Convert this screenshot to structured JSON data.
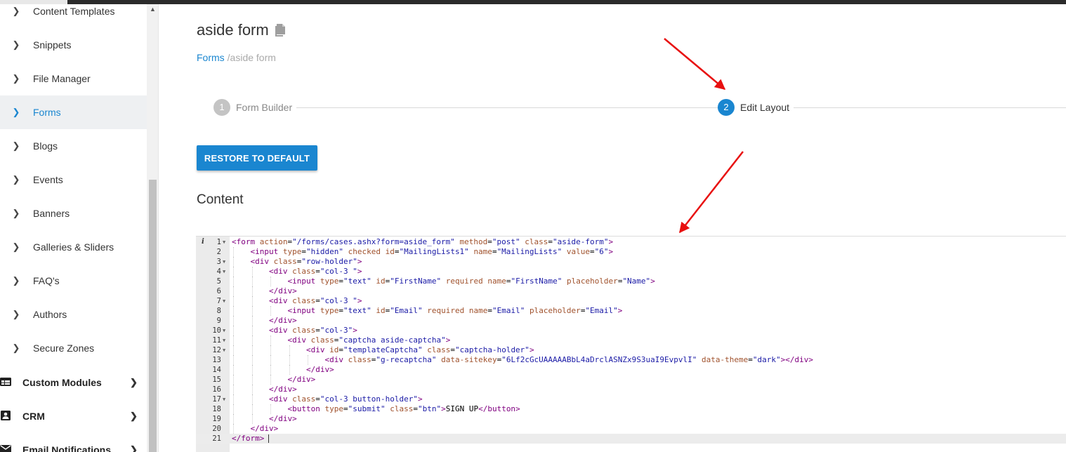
{
  "sidebar": {
    "items": [
      {
        "label": "Content Templates",
        "active": false
      },
      {
        "label": "Snippets",
        "active": false
      },
      {
        "label": "File Manager",
        "active": false
      },
      {
        "label": "Forms",
        "active": true
      },
      {
        "label": "Blogs",
        "active": false
      },
      {
        "label": "Events",
        "active": false
      },
      {
        "label": "Banners",
        "active": false
      },
      {
        "label": "Galleries & Sliders",
        "active": false
      },
      {
        "label": "FAQ's",
        "active": false
      },
      {
        "label": "Authors",
        "active": false
      },
      {
        "label": "Secure Zones",
        "active": false
      }
    ],
    "sections": [
      {
        "label": "Custom Modules",
        "icon": "module-icon"
      },
      {
        "label": "CRM",
        "icon": "contact-card-icon"
      },
      {
        "label": "Email Notifications",
        "icon": "envelope-icon"
      }
    ]
  },
  "page": {
    "title": "aside form",
    "breadcrumb": {
      "link": "Forms",
      "current": "/aside form"
    }
  },
  "stepper": {
    "steps": [
      {
        "num": "1",
        "label": "Form Builder",
        "state": "inactive"
      },
      {
        "num": "2",
        "label": "Edit Layout",
        "state": "active"
      }
    ]
  },
  "actions": {
    "restore_label": "RESTORE TO DEFAULT"
  },
  "content": {
    "heading": "Content"
  },
  "editor": {
    "lines": [
      {
        "n": "1",
        "fold": true,
        "indent": 0,
        "code": "<form action=\"/forms/cases.ashx?form=aside_form\" method=\"post\" class=\"aside-form\">"
      },
      {
        "n": "2",
        "fold": false,
        "indent": 1,
        "code": "<input type=\"hidden\" checked id=\"MailingLists1\" name=\"MailingLists\" value=\"6\">"
      },
      {
        "n": "3",
        "fold": true,
        "indent": 1,
        "code": "<div class=\"row-holder\">"
      },
      {
        "n": "4",
        "fold": true,
        "indent": 2,
        "code": "<div class=\"col-3 \">"
      },
      {
        "n": "5",
        "fold": false,
        "indent": 3,
        "code": "<input type=\"text\" id=\"FirstName\" required name=\"FirstName\" placeholder=\"Name\">"
      },
      {
        "n": "6",
        "fold": false,
        "indent": 2,
        "code": "</div>"
      },
      {
        "n": "7",
        "fold": true,
        "indent": 2,
        "code": "<div class=\"col-3 \">"
      },
      {
        "n": "8",
        "fold": false,
        "indent": 3,
        "code": "<input type=\"text\" id=\"Email\" required name=\"Email\" placeholder=\"Email\">"
      },
      {
        "n": "9",
        "fold": false,
        "indent": 2,
        "code": "</div>"
      },
      {
        "n": "10",
        "fold": true,
        "indent": 2,
        "code": "<div class=\"col-3\">"
      },
      {
        "n": "11",
        "fold": true,
        "indent": 3,
        "code": "<div class=\"captcha aside-captcha\">"
      },
      {
        "n": "12",
        "fold": true,
        "indent": 4,
        "code": "<div id=\"templateCaptcha\" class=\"captcha-holder\">"
      },
      {
        "n": "13",
        "fold": false,
        "indent": 5,
        "code": "<div class=\"g-recaptcha\" data-sitekey=\"6Lf2cGcUAAAAABbL4aDrclASNZx9S3uaI9EvpvlI\" data-theme=\"dark\"></div>"
      },
      {
        "n": "14",
        "fold": false,
        "indent": 4,
        "code": "</div>"
      },
      {
        "n": "15",
        "fold": false,
        "indent": 3,
        "code": "</div>"
      },
      {
        "n": "16",
        "fold": false,
        "indent": 2,
        "code": "</div>"
      },
      {
        "n": "17",
        "fold": true,
        "indent": 2,
        "code": "<div class=\"col-3 button-holder\">"
      },
      {
        "n": "18",
        "fold": false,
        "indent": 3,
        "code": "<button type=\"submit\" class=\"btn\">SIGN UP</button>"
      },
      {
        "n": "19",
        "fold": false,
        "indent": 2,
        "code": "</div>"
      },
      {
        "n": "20",
        "fold": false,
        "indent": 1,
        "code": "</div>"
      },
      {
        "n": "21",
        "fold": false,
        "indent": 0,
        "code": "</form>",
        "active": true
      }
    ]
  },
  "colors": {
    "accent": "#1a86d0",
    "annotation_arrow": "#e81010",
    "tag": "#800080",
    "attribute": "#a0522d",
    "value": "#1a1aa6"
  }
}
